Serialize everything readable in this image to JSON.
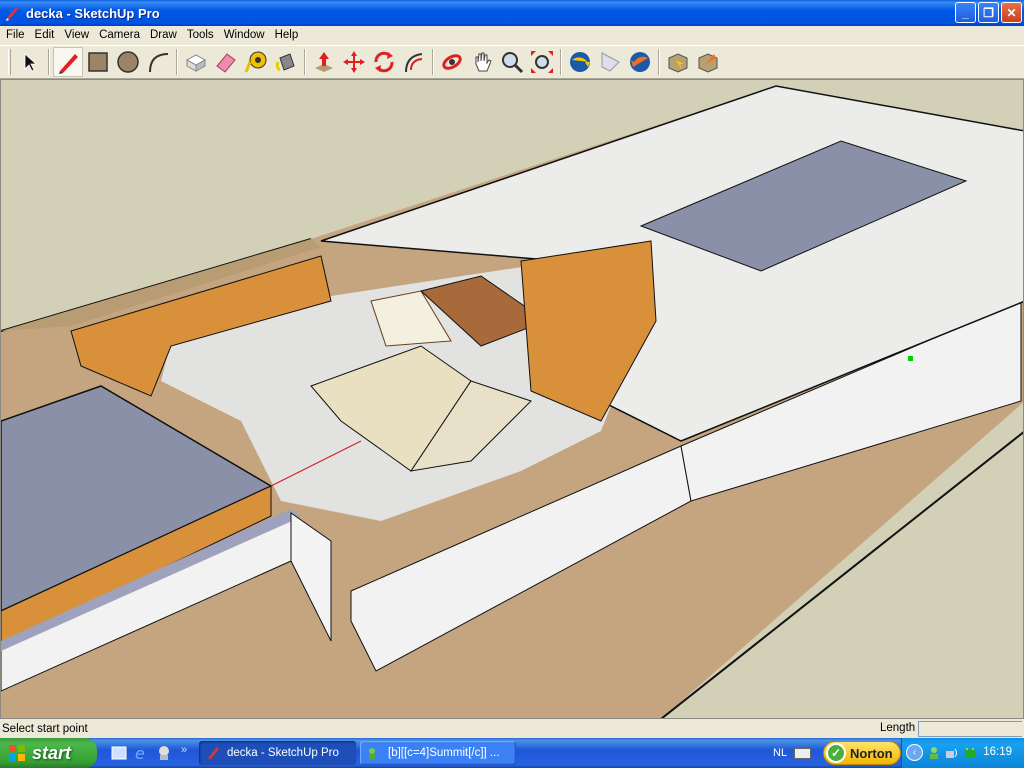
{
  "window": {
    "title": "decka - SketchUp Pro",
    "minimize_label": "_",
    "restore_label": "❐",
    "close_label": "✕"
  },
  "menubar": {
    "items": [
      "File",
      "Edit",
      "View",
      "Camera",
      "Draw",
      "Tools",
      "Window",
      "Help"
    ]
  },
  "toolbar": {
    "tools": [
      {
        "name": "select",
        "icon": "select-arrow-icon",
        "active": false
      },
      {
        "name": "pencil",
        "icon": "pencil-icon",
        "active": true
      },
      {
        "name": "rectangle",
        "icon": "rectangle-icon",
        "active": false
      },
      {
        "name": "circle",
        "icon": "circle-icon",
        "active": false
      },
      {
        "name": "arc",
        "icon": "arc-icon",
        "active": false
      },
      {
        "name": "make-component",
        "icon": "component-icon",
        "active": false
      },
      {
        "name": "eraser",
        "icon": "eraser-icon",
        "active": false
      },
      {
        "name": "tape-measure",
        "icon": "tape-measure-icon",
        "active": false
      },
      {
        "name": "paint-bucket",
        "icon": "paint-bucket-icon",
        "active": false
      },
      {
        "name": "push-pull",
        "icon": "push-pull-icon",
        "active": false
      },
      {
        "name": "move",
        "icon": "move-icon",
        "active": false
      },
      {
        "name": "rotate",
        "icon": "rotate-icon",
        "active": false
      },
      {
        "name": "offset",
        "icon": "offset-icon",
        "active": false
      },
      {
        "name": "orbit",
        "icon": "orbit-icon",
        "active": false
      },
      {
        "name": "pan",
        "icon": "pan-hand-icon",
        "active": false
      },
      {
        "name": "zoom",
        "icon": "zoom-icon",
        "active": false
      },
      {
        "name": "zoom-extents",
        "icon": "zoom-extents-icon",
        "active": false
      },
      {
        "name": "get-models",
        "icon": "globe-get-icon",
        "active": false
      },
      {
        "name": "share-model",
        "icon": "share-model-icon",
        "active": false
      },
      {
        "name": "upload-model",
        "icon": "globe-upload-icon",
        "active": false
      },
      {
        "name": "get-component",
        "icon": "box-get-icon",
        "active": false
      },
      {
        "name": "share-component",
        "icon": "box-share-icon",
        "active": false
      }
    ]
  },
  "viewport": {
    "scene": "3D building floor plan model",
    "colors": {
      "sky": "#d3d0b8",
      "ground_wood": "#c4a580",
      "floor_tile": "#e2e2e0",
      "roof_slab": "#8a90a8",
      "wall_white": "#f2f2f2",
      "wall_orange": "#d8913a",
      "wall_top": "#9ea2bc",
      "wood_trim": "#8a4a22"
    }
  },
  "statusbar": {
    "message": "Select start point",
    "vcb_label": "Length",
    "vcb_value": ""
  },
  "taskbar": {
    "start_label": "start",
    "quicklaunch_more": "»",
    "tasks": [
      {
        "label": "decka - SketchUp Pro",
        "active": true
      },
      {
        "label": "[b][[c=4]Summit[/c]] ...",
        "active": false
      }
    ],
    "language": "NL",
    "norton_label": "Norton",
    "clock": "16:19"
  }
}
